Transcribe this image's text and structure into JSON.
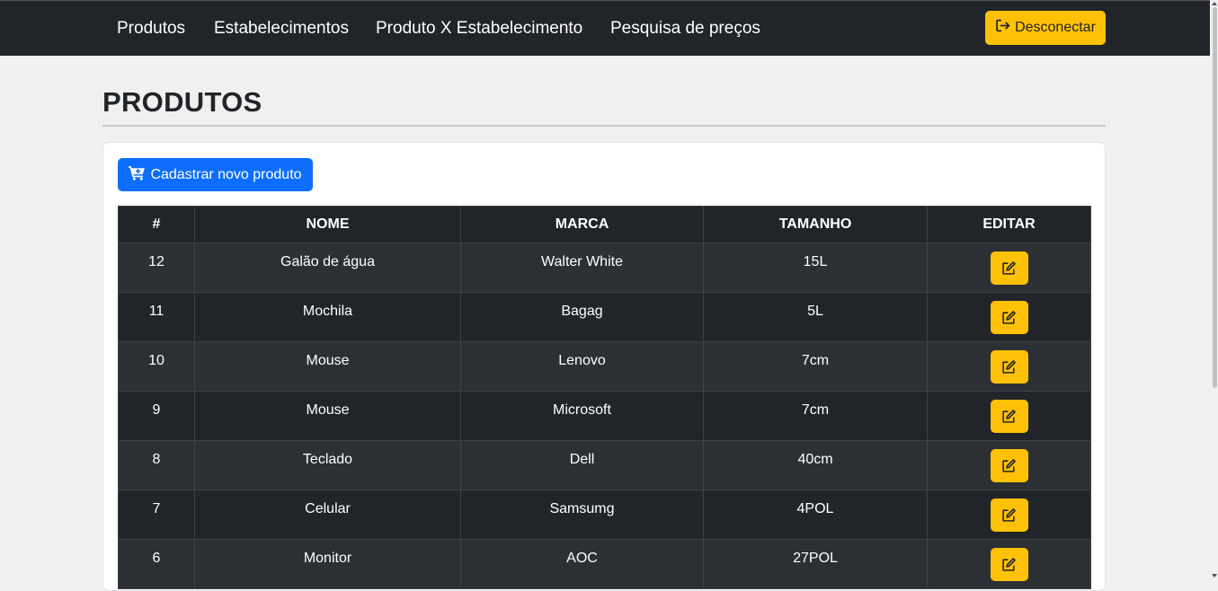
{
  "nav": {
    "links": [
      "Produtos",
      "Estabelecimentos",
      "Produto X Estabelecimento",
      "Pesquisa de preços"
    ],
    "logout_label": "Desconectar",
    "logout_icon": "sign-out-icon"
  },
  "page": {
    "title": "PRODUTOS",
    "new_button_label": "Cadastrar novo produto",
    "new_button_icon": "cart-plus-icon"
  },
  "table": {
    "headers": [
      "#",
      "NOME",
      "MARCA",
      "TAMANHO",
      "EDITAR"
    ],
    "rows": [
      {
        "id": "12",
        "nome": "Galão de água",
        "marca": "Walter White",
        "tamanho": "15L"
      },
      {
        "id": "11",
        "nome": "Mochila",
        "marca": "Bagag",
        "tamanho": "5L"
      },
      {
        "id": "10",
        "nome": "Mouse",
        "marca": "Lenovo",
        "tamanho": "7cm"
      },
      {
        "id": "9",
        "nome": "Mouse",
        "marca": "Microsoft",
        "tamanho": "7cm"
      },
      {
        "id": "8",
        "nome": "Teclado",
        "marca": "Dell",
        "tamanho": "40cm"
      },
      {
        "id": "7",
        "nome": "Celular",
        "marca": "Samsumg",
        "tamanho": "4POL"
      },
      {
        "id": "6",
        "nome": "Monitor",
        "marca": "AOC",
        "tamanho": "27POL"
      }
    ],
    "edit_icon": "edit-icon"
  },
  "colors": {
    "navbar": "#212529",
    "primary": "#0d6efd",
    "warning": "#ffc107",
    "table_dark": "#212529",
    "table_striped": "#2c3034",
    "background": "#f0f0f0"
  }
}
